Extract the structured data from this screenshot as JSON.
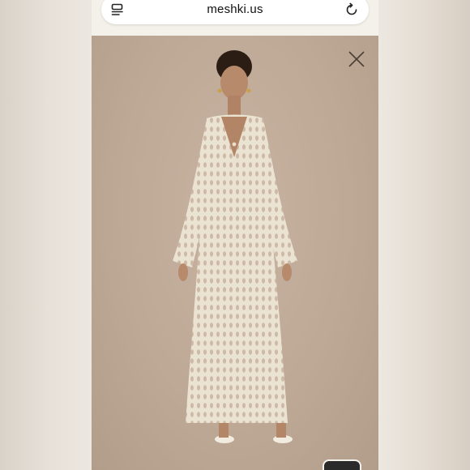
{
  "browser": {
    "url": "meshki.us",
    "reader_icon": "reader-mode-icon",
    "reload_icon": "reload-icon"
  },
  "viewer": {
    "close_icon": "close-icon",
    "image_subject": "model-in-cream-crochet-maxi-dress"
  },
  "colors": {
    "backdrop": "#bea896",
    "dress": "#ece4d2",
    "page": "#f4f1ea"
  }
}
